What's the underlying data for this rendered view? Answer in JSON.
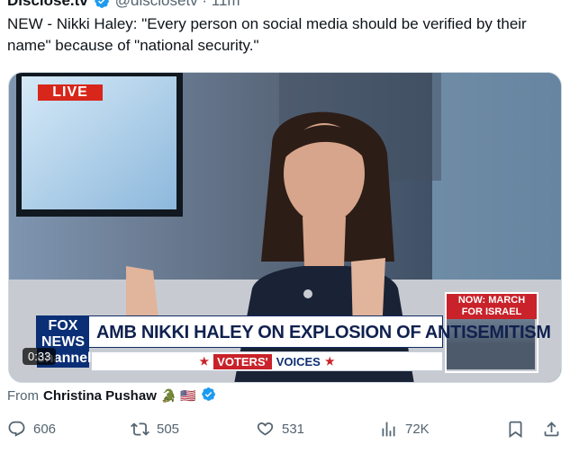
{
  "tweet": {
    "author_name": "Disclose.tv",
    "handle_time": "@disclosetv · 11m",
    "text": "NEW - Nikki Haley: \"Every person on social media should be verified by their name\" because of \"national security.\""
  },
  "video": {
    "live_badge": "LIVE",
    "side_box_title": "NOW: MARCH FOR ISRAEL",
    "logo_text": "FOX NEWS channel",
    "headline": "AMB NIKKI HALEY ON EXPLOSION OF ANTISEMITISM",
    "ticker_left": "VOTERS'",
    "ticker_right": "VOICES",
    "timer": "0:33"
  },
  "attribution": {
    "prefix": "From",
    "name": "Christina Pushaw",
    "emojis": "🐊 🇺🇸"
  },
  "actions": {
    "replies": "606",
    "reposts": "505",
    "likes": "531",
    "views": "72K"
  },
  "icons": [
    "verified-badge-icon",
    "reply-icon",
    "repost-icon",
    "like-icon",
    "views-icon",
    "bookmark-icon",
    "share-icon"
  ],
  "colors": {
    "verified_blue": "#1d9bf0",
    "text_secondary": "#536471",
    "fox_red": "#c9222a",
    "fox_navy": "#10214f"
  }
}
